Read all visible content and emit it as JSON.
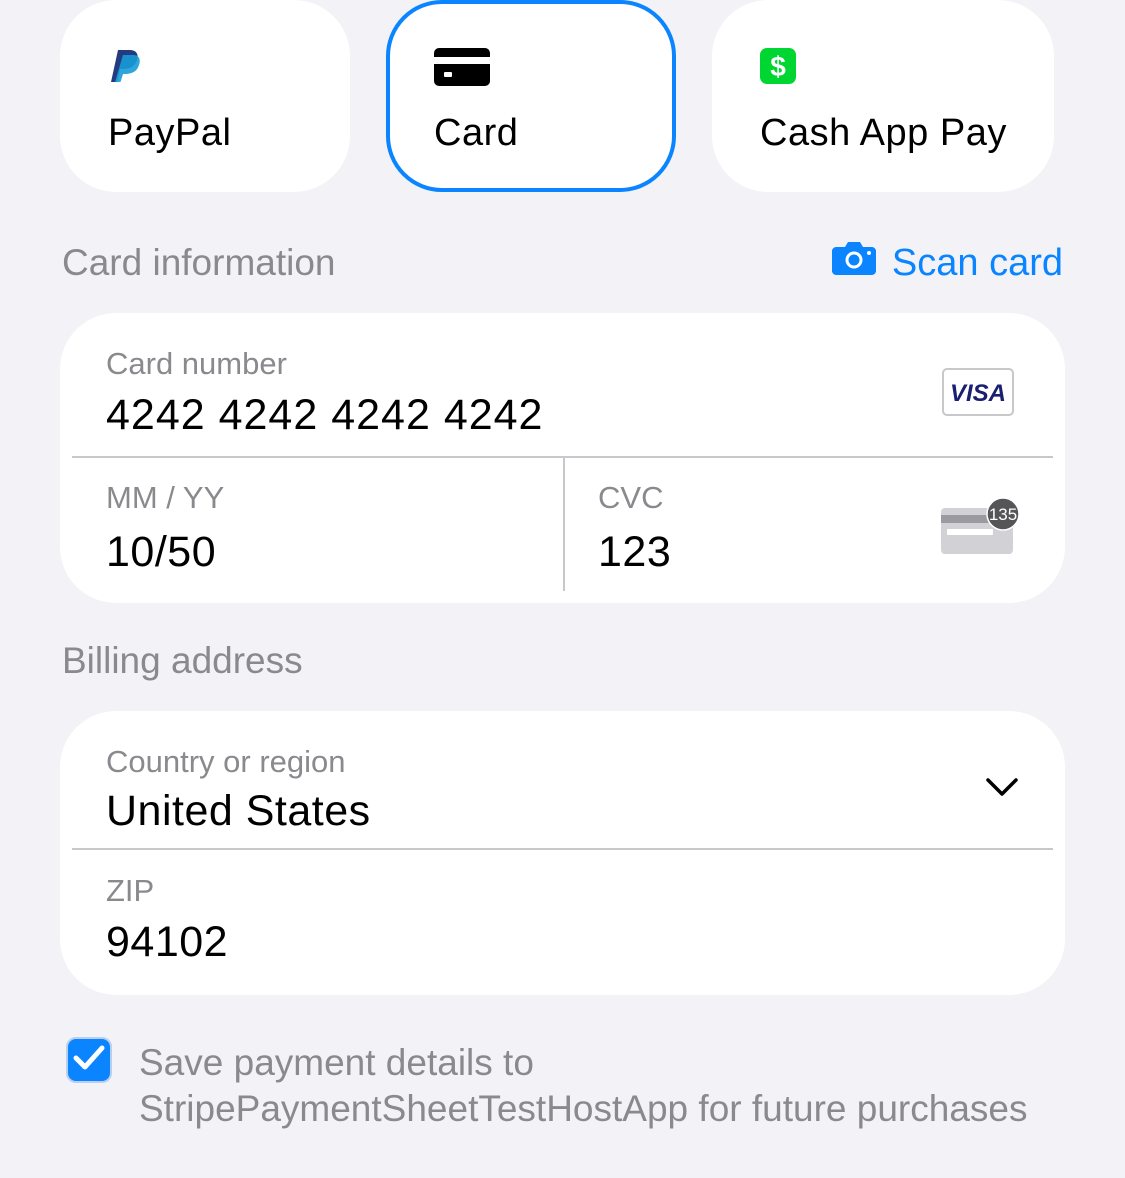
{
  "payment_methods": [
    {
      "label": "PayPal",
      "icon": "paypal-icon",
      "selected": false
    },
    {
      "label": "Card",
      "icon": "card-icon",
      "selected": true
    },
    {
      "label": "Cash App Pay",
      "icon": "cash-app-icon",
      "selected": false
    }
  ],
  "card_section": {
    "title": "Card information",
    "scan_label": "Scan card",
    "scan_icon": "camera-icon"
  },
  "card_form": {
    "number_label": "Card number",
    "number_value": "4242 4242 4242 4242",
    "brand_badge": "VISA",
    "expiry_label": "MM / YY",
    "expiry_value": "10/50",
    "cvc_label": "CVC",
    "cvc_value": "123",
    "cvc_hint": "135"
  },
  "billing_section": {
    "title": "Billing address"
  },
  "billing_form": {
    "country_label": "Country or region",
    "country_value": "United States",
    "zip_label": "ZIP",
    "zip_value": "94102"
  },
  "save_option": {
    "checked": true,
    "text": "Save payment details to StripePaymentSheetTestHostApp for future purchases"
  },
  "colors": {
    "accent": "#0a84ff",
    "background": "#f2f2f7",
    "secondary_text": "#8a8a8e",
    "cash_app_green": "#00d632",
    "paypal_dark": "#253b80",
    "paypal_light": "#179bd7",
    "visa_blue": "#1a1f71"
  }
}
